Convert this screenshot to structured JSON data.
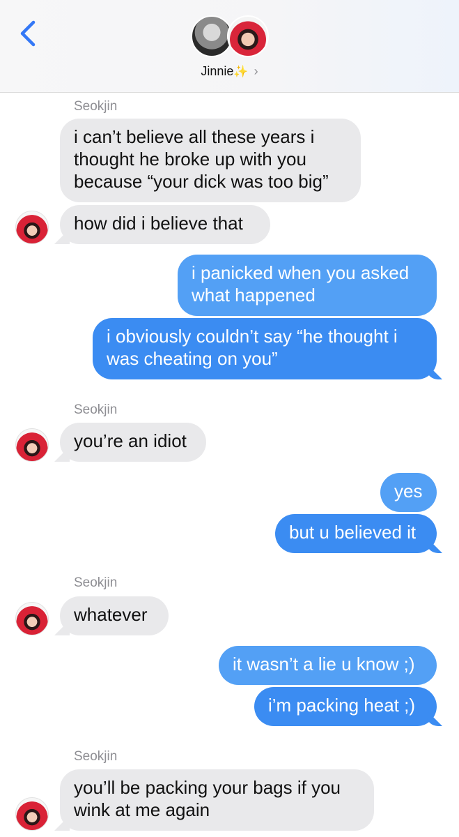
{
  "header": {
    "contact_name": "Jinnie",
    "sparkle": "✨",
    "chevron": "›"
  },
  "messages": [
    {
      "sender": "Seokjin",
      "text": "i can’t believe all these years i thought he broke up with you because “your dick was too big”",
      "dir": "in"
    },
    {
      "text": "how did i believe that",
      "dir": "in"
    },
    {
      "text": "i panicked when you asked what happened",
      "dir": "out"
    },
    {
      "text": "i obviously couldn’t say “he thought i was cheating on you”",
      "dir": "out"
    },
    {
      "sender": "Seokjin",
      "text": "you’re an idiot",
      "dir": "in"
    },
    {
      "text": "yes",
      "dir": "out"
    },
    {
      "text": "but u believed it",
      "dir": "out"
    },
    {
      "sender": "Seokjin",
      "text": "whatever",
      "dir": "in"
    },
    {
      "text": "it wasn’t a lie u know ;)",
      "dir": "out"
    },
    {
      "text": "i’m packing heat ;)",
      "dir": "out"
    },
    {
      "sender": "Seokjin",
      "text": "you’ll be packing your bags if you wink at me again",
      "dir": "in"
    }
  ],
  "icons": {
    "back": "chevron-left-icon"
  },
  "colors": {
    "incoming_bubble": "#e9e9eb",
    "outgoing_bubble": "#3b8cf2",
    "back_arrow": "#3478f6"
  }
}
